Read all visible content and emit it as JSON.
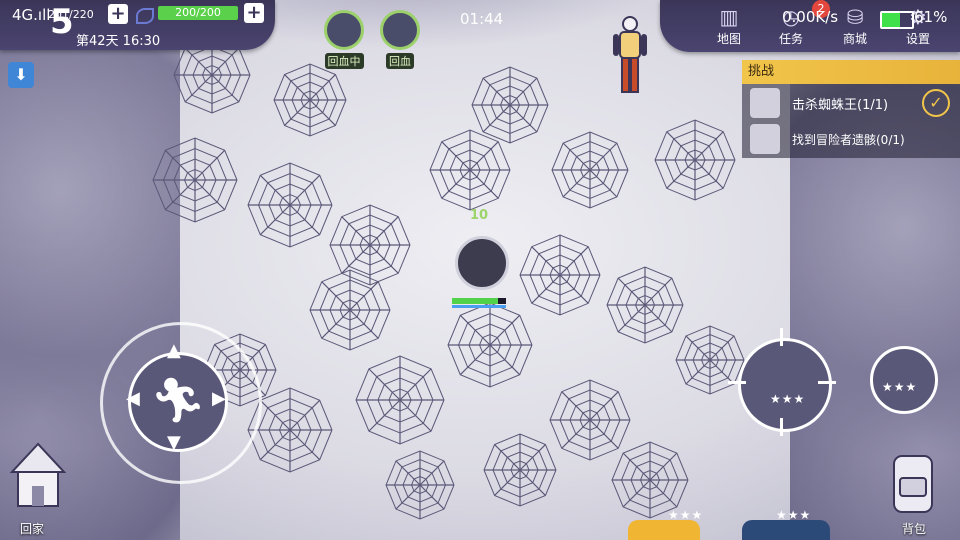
{
  "hud": {
    "signal": "4G.ıll",
    "day_number": "5",
    "food": "201/220",
    "health": "200/200",
    "health_fraction": 1.0,
    "day_time": "第42天 16:30",
    "clock": "01:44",
    "net_speed": "0.00K/s",
    "battery": "61%",
    "battery_fraction": 0.61,
    "notification_count": "2"
  },
  "buffs": [
    {
      "label": "回血中",
      "icon": "heart-regen-icon"
    },
    {
      "label": "回血",
      "icon": "bandage-icon"
    }
  ],
  "menu": [
    {
      "label": "地图",
      "icon": "map-icon"
    },
    {
      "label": "任务",
      "icon": "alarm-clock-icon"
    },
    {
      "label": "商城",
      "icon": "coins-icon"
    },
    {
      "label": "设置",
      "icon": "gear-icon"
    }
  ],
  "challenge": {
    "title": "挑战",
    "tasks": [
      {
        "text": "击杀蜘蛛王(1/1)",
        "done": true
      },
      {
        "text": "找到冒险者遗骸(0/1)",
        "done": false
      }
    ]
  },
  "player": {
    "hp_fraction": 0.85,
    "damage_text": "10"
  },
  "bottom": {
    "home_label": "回家",
    "bag_label": "背包",
    "slot1_stars": "★★★",
    "slot2_stars": "★★★",
    "attack_stars": "★★★",
    "skill_stars": "★★★"
  },
  "colors": {
    "accent": "#f1c54a",
    "panel": "#3b3658",
    "health": "#5bd04a",
    "slot_gold": "#f1b534",
    "slot_blue": "#2c4a78"
  }
}
